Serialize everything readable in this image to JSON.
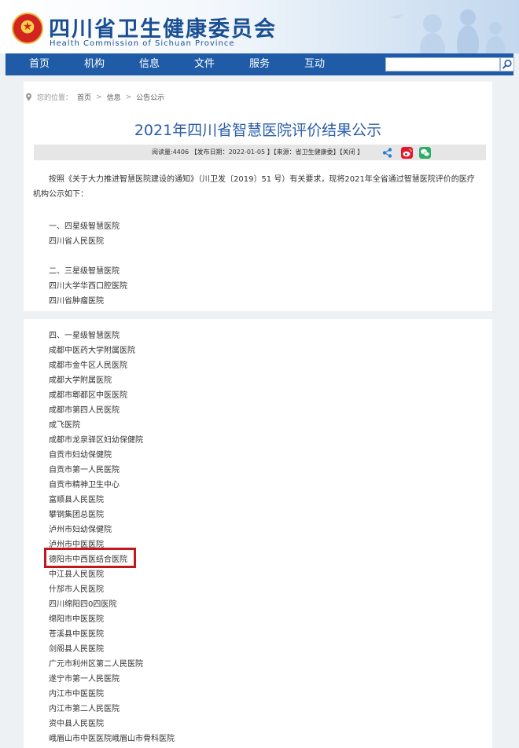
{
  "header": {
    "title": "四川省卫生健康委员会",
    "subtitle": "Health Commission of Sichuan Province"
  },
  "nav": {
    "items": [
      "首页",
      "机构",
      "信息",
      "文件",
      "服务",
      "互动"
    ],
    "search_placeholder": ""
  },
  "breadcrumb": {
    "prefix": "您的位置：",
    "items": [
      "首页",
      "信息",
      "公告公示"
    ],
    "separator": ">"
  },
  "article": {
    "title": "2021年四川省智慧医院评价结果公示",
    "meta": "阅读量:4406 【发布日期：2022-01-05 】【来源：省卫生健康委】【关闭 】",
    "intro": "按照《关于大力推进智慧医院建设的通知》（川卫发〔2019〕51 号）有关要求，现将2021年全省通过智慧医院评价的医疗机构公示如下：",
    "sections": [
      {
        "heading": "一、四星级智慧医院",
        "hospitals": [
          "四川省人民医院"
        ]
      },
      {
        "heading": "二、三星级智慧医院",
        "hospitals": [
          "四川大学华西口腔医院",
          "四川省肿瘤医院"
        ]
      },
      {
        "heading": "四、一星级智慧医院",
        "hospitals": [
          "成都中医药大学附属医院",
          "成都市金牛区人民医院",
          "成都大学附属医院",
          "成都市郫都区中医医院",
          "成都市第四人民医院",
          "成飞医院",
          "成都市龙泉驿区妇幼保健院",
          "自贡市妇幼保健院",
          "自贡市第一人民医院",
          "自贡市精神卫生中心",
          "富顺县人民医院",
          "攀钢集团总医院",
          "泸州市妇幼保健院",
          "泸州市中医医院",
          "德阳市中西医结合医院",
          "中江县人民医院",
          "什邡市人民医院",
          "四川绵阳四0四医院",
          "绵阳市中医医院",
          "苍溪县中医医院",
          "剑阁县人民医院",
          "广元市利州区第二人民医院",
          "遂宁市第一人民医院",
          "内江市中医医院",
          "内江市第二人民医院",
          "资中县人民医院",
          "峨眉山市中医医院峨眉山市骨科医院"
        ]
      }
    ]
  },
  "colors": {
    "nav_bg": "#1f5ba6",
    "title": "#2a5ea8",
    "highlight_border": "#c0181d",
    "weibo": "#e6162d",
    "wechat": "#2aae67",
    "share": "#2a7fd4"
  },
  "icons": [
    "national-emblem-icon",
    "search-icon",
    "location-pin-icon",
    "share-icon",
    "weibo-icon",
    "wechat-icon"
  ]
}
